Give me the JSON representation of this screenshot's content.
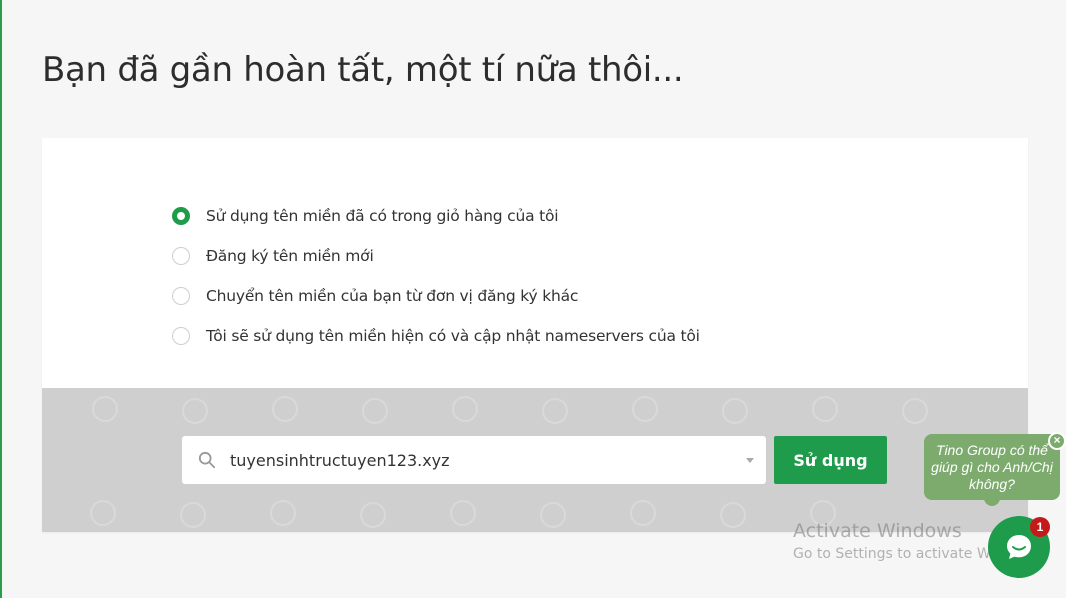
{
  "page_title": "Bạn đã gần hoàn tất, một tí nữa thôi...",
  "options": [
    {
      "label": "Sử dụng tên miền đã có trong giỏ hàng của tôi",
      "checked": true
    },
    {
      "label": "Đăng ký tên miền mới",
      "checked": false
    },
    {
      "label": "Chuyển tên miền của bạn từ đơn vị đăng ký khác",
      "checked": false
    },
    {
      "label": "Tôi sẽ sử dụng tên miền hiện có và cập nhật nameservers của tôi",
      "checked": false
    }
  ],
  "search": {
    "value": "tuyensinhtructuyen123.xyz",
    "icon": "search-icon"
  },
  "use_button_label": "Sử dụng",
  "watermark": {
    "title": "Activate Windows",
    "subtitle": "Go to Settings to activate Windows."
  },
  "chat": {
    "bubble_text": "Tino Group có thể giúp gì cho Anh/Chị không?",
    "close_label": "×",
    "badge_count": "1"
  },
  "colors": {
    "accent": "#1e9c4c",
    "band": "#cfcfcf",
    "bubble": "#7dab6e",
    "badge": "#c41a1a"
  }
}
